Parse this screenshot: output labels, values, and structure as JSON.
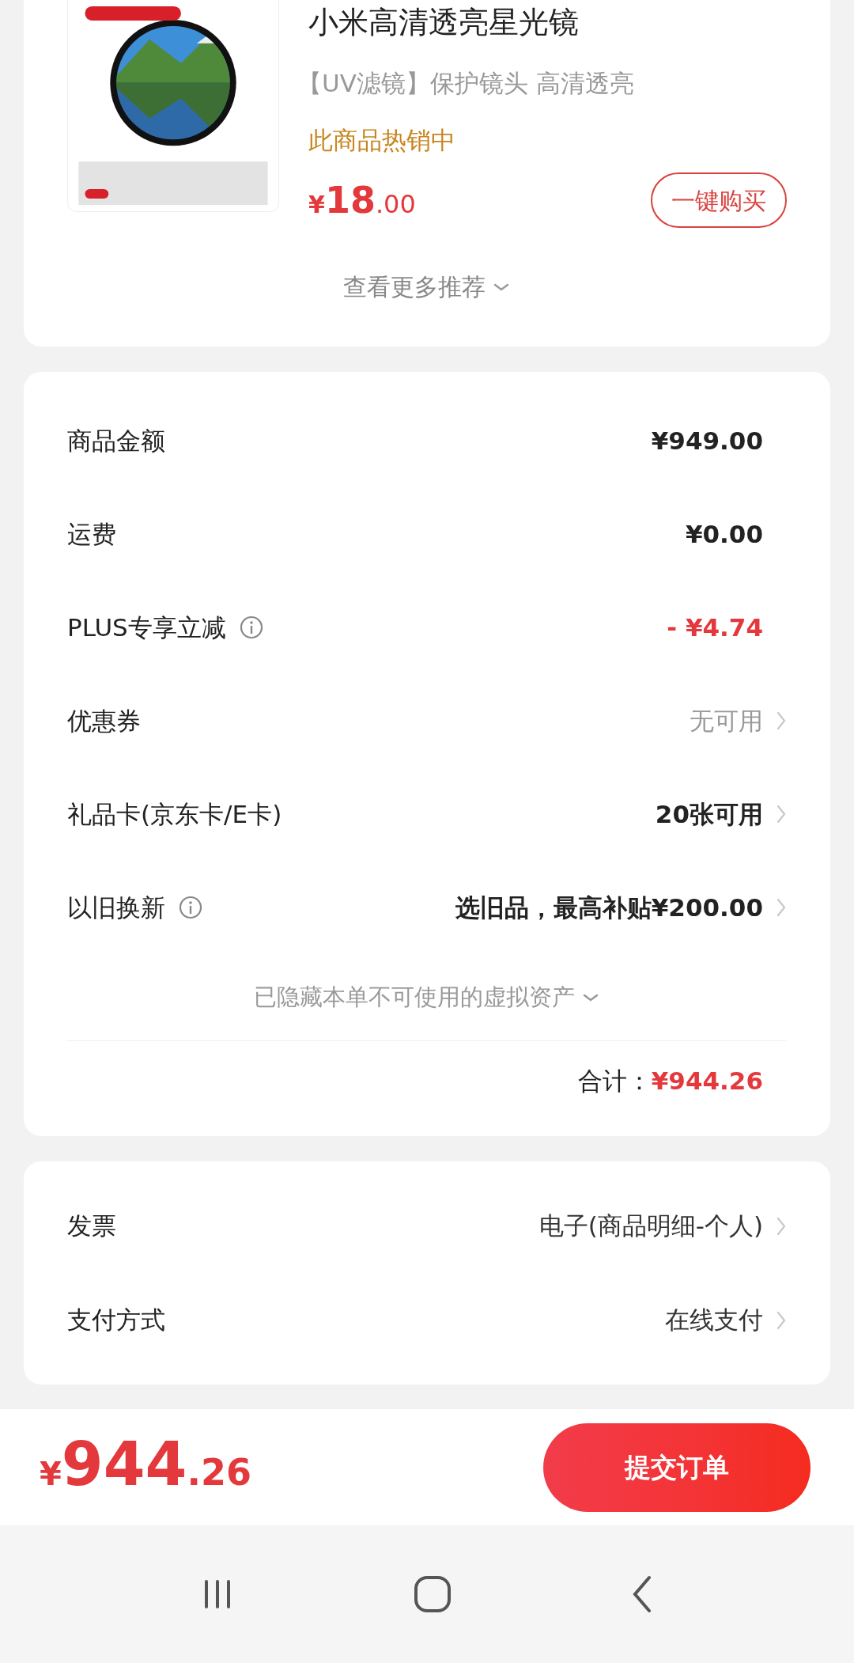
{
  "product": {
    "kind": "picture",
    "title": "小米高清透亮星光镜",
    "subtitle": "【UV滤镜】保护镜头 高清透亮",
    "hot": "此商品热销中",
    "price": {
      "currency": "¥",
      "integer": "18",
      "decimal": ".00"
    },
    "buy_button": "一键购买"
  },
  "more_recommend": "查看更多推荐",
  "summary": {
    "rows": [
      {
        "label": "商品金额",
        "info": false,
        "value": "¥949.00",
        "kind": "strong",
        "arrow": false
      },
      {
        "label": "运费",
        "info": false,
        "value": "¥0.00",
        "kind": "strong",
        "arrow": false
      },
      {
        "label": "PLUS专享立减",
        "info": true,
        "value": "- ¥4.74",
        "kind": "discount",
        "arrow": false
      },
      {
        "label": "优惠券",
        "info": false,
        "value": "无可用",
        "kind": "muted",
        "arrow": true
      },
      {
        "label": "礼品卡(京东卡/E卡)",
        "info": false,
        "value": "20张可用",
        "kind": "strong",
        "arrow": true
      },
      {
        "label": "以旧换新",
        "info": true,
        "value": "选旧品，最高补贴¥200.00",
        "kind": "strong",
        "arrow": true
      }
    ],
    "hidden_assets": "已隐藏本单不可使用的虚拟资产",
    "total_label": "合计：",
    "total_value": "¥944.26"
  },
  "options": [
    {
      "label": "发票",
      "value": "电子(商品明细-个人)"
    },
    {
      "label": "支付方式",
      "value": "在线支付"
    }
  ],
  "bottom_bar": {
    "currency": "¥",
    "integer": "944",
    "decimal": ".26",
    "submit": "提交订单"
  }
}
